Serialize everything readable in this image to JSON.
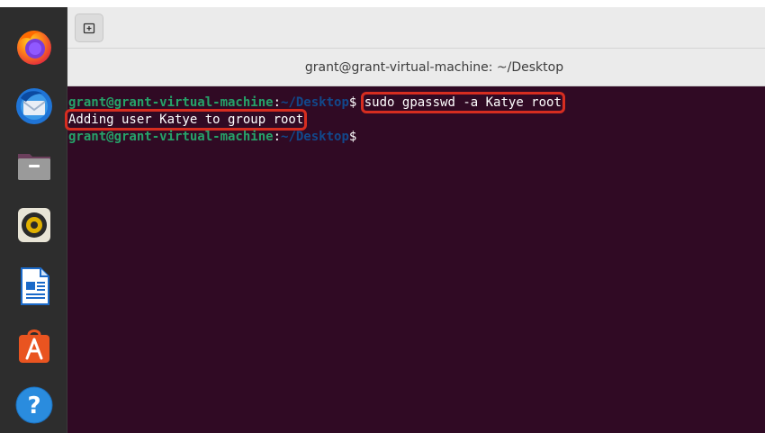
{
  "window": {
    "title": "grant@grant-virtual-machine: ~/Desktop"
  },
  "dock": {
    "items": [
      {
        "name": "firefox-icon"
      },
      {
        "name": "thunderbird-icon"
      },
      {
        "name": "files-icon"
      },
      {
        "name": "rhythmbox-icon"
      },
      {
        "name": "libreoffice-writer-icon"
      },
      {
        "name": "software-center-icon"
      },
      {
        "name": "help-icon"
      }
    ]
  },
  "terminal": {
    "prompt_user": "grant@grant-virtual-machine",
    "prompt_sep": ":",
    "prompt_path": "~/Desktop",
    "prompt_dollar": "$",
    "command": "sudo gpasswd -a Katye root",
    "output": "Adding user Katye to group root"
  },
  "colors": {
    "terminal_bg": "#300a24",
    "prompt_user": "#26a269",
    "prompt_path": "#12488b",
    "highlight": "#d62d20"
  }
}
